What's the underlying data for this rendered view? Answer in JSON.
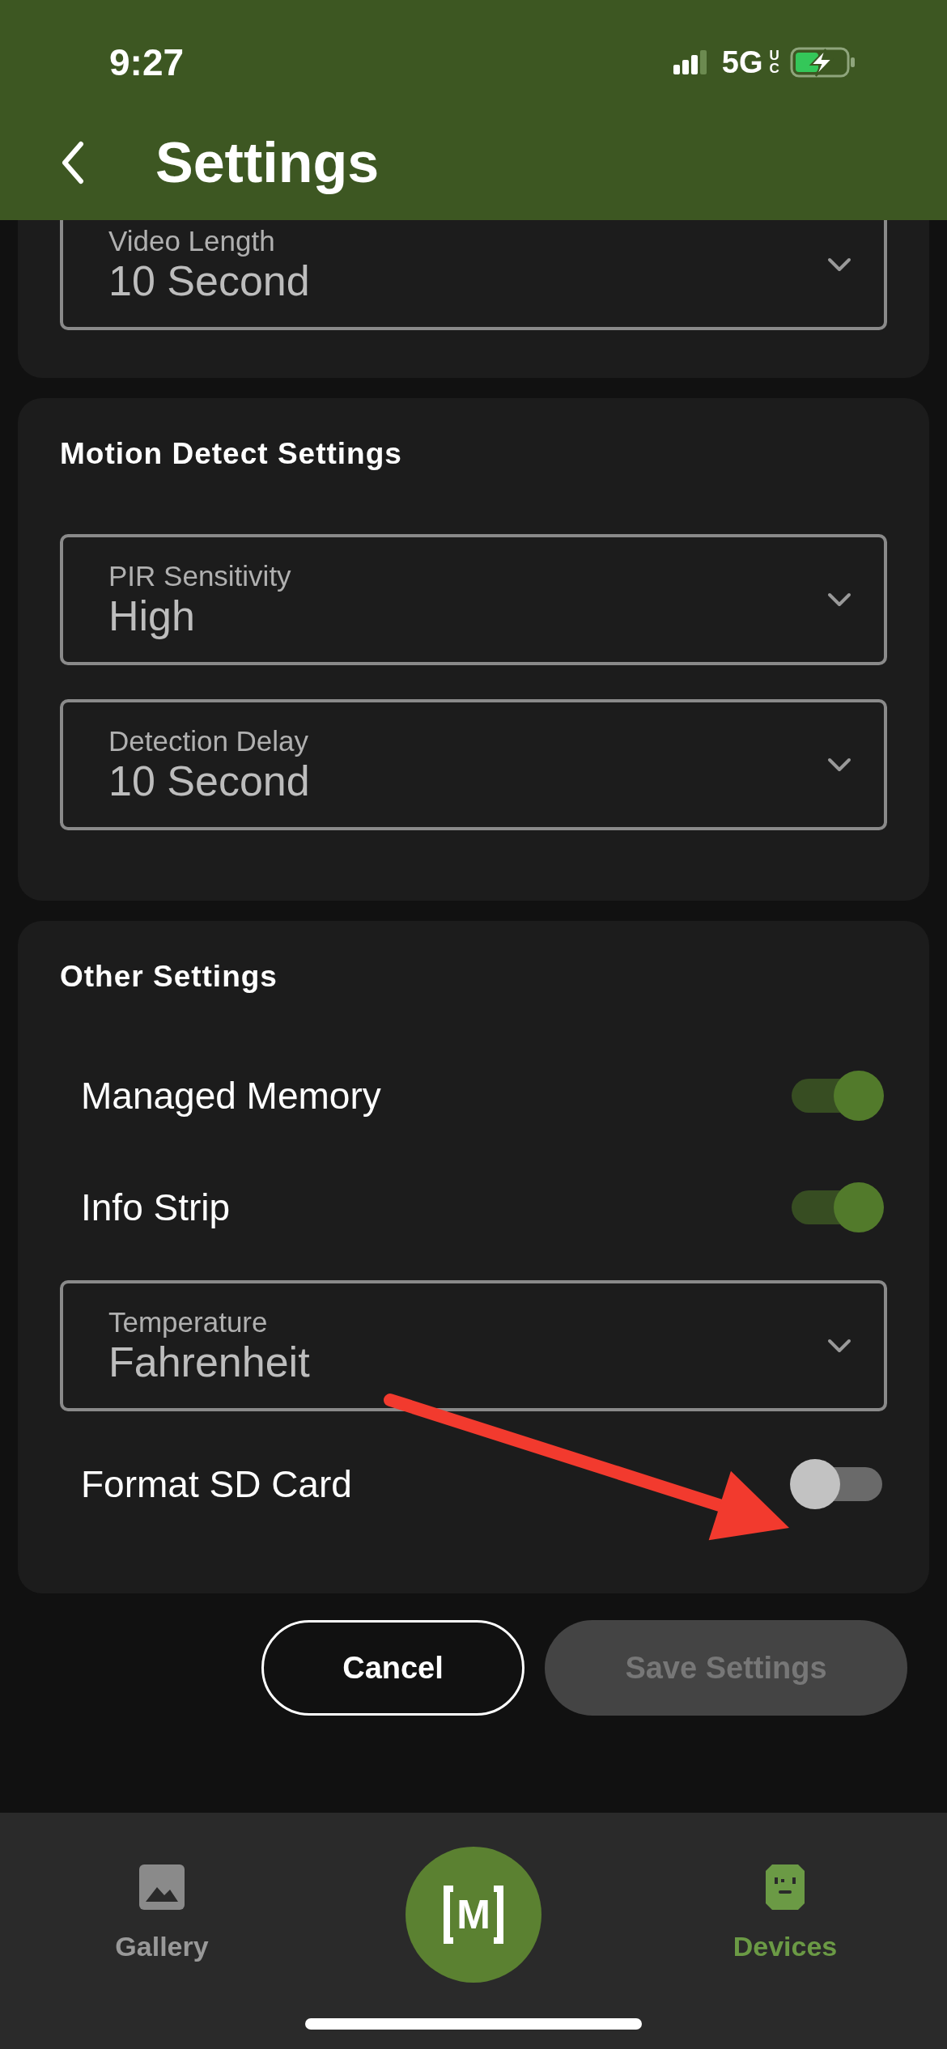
{
  "status_bar": {
    "time": "9:27",
    "network": "5G",
    "network_mark": "UC"
  },
  "header": {
    "title": "Settings"
  },
  "sections": [
    {
      "fields": [
        {
          "kind": "select",
          "label": "Video Length",
          "value": "10 Second"
        }
      ]
    },
    {
      "title": "Motion Detect Settings",
      "fields": [
        {
          "kind": "select",
          "label": "PIR Sensitivity",
          "value": "High"
        },
        {
          "kind": "select",
          "label": "Detection Delay",
          "value": "10 Second"
        }
      ]
    },
    {
      "title": "Other Settings",
      "fields": [
        {
          "kind": "toggle",
          "label": "Managed Memory",
          "on": true
        },
        {
          "kind": "toggle",
          "label": "Info Strip",
          "on": true
        },
        {
          "kind": "select",
          "label": "Temperature",
          "value": "Fahrenheit"
        },
        {
          "kind": "toggle",
          "label": "Format SD Card",
          "on": false
        }
      ]
    }
  ],
  "buttons": [
    {
      "label": "Cancel",
      "disabled": false
    },
    {
      "label": "Save Settings",
      "disabled": true
    }
  ],
  "tab_bar": {
    "items": [
      {
        "kind": "gallery",
        "label": "Gallery",
        "selected": false
      },
      {
        "kind": "logo",
        "label": "M"
      },
      {
        "kind": "devices",
        "label": "Devices",
        "selected": true
      }
    ]
  }
}
